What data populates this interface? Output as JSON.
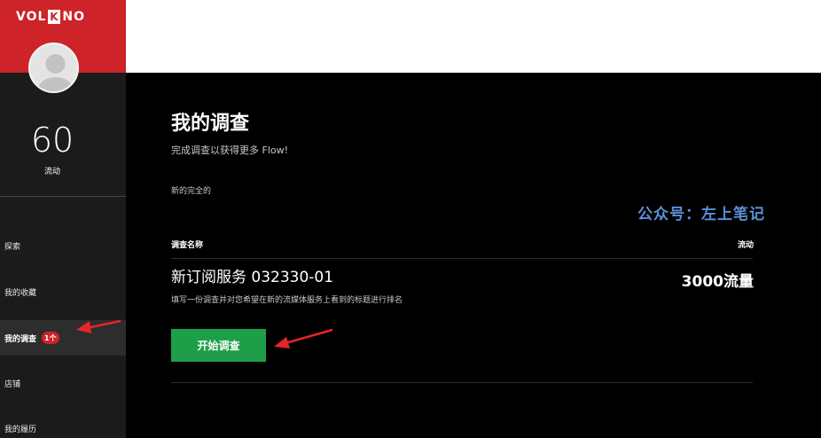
{
  "brand": {
    "logo_left": "VOL",
    "logo_box": "K",
    "logo_right": "NO"
  },
  "user": {
    "points": "60",
    "points_label": "流动"
  },
  "nav": {
    "items": [
      {
        "label": "探索"
      },
      {
        "label": "我的收藏"
      },
      {
        "label": "我的调查",
        "badge": "1个"
      },
      {
        "label": "店铺"
      },
      {
        "label": "我的履历"
      }
    ]
  },
  "main": {
    "title": "我的调查",
    "subtitle": "完成调查以获得更多 Flow!",
    "section_label": "新的完全的",
    "watermark": "公众号：左上笔记",
    "table": {
      "col_name": "调查名称",
      "col_flow": "流动"
    },
    "survey": {
      "name": "新订阅服务 032330-01",
      "description": "填写一份调查并对您希望在新的流媒体服务上看到的标题进行排名",
      "flow": "3000流量",
      "button": "开始调查"
    }
  },
  "colors": {
    "brand_red": "#cd2329",
    "button_green": "#1f9e49",
    "annotation_red": "#e8242b",
    "watermark_blue": "#5b8fd6"
  }
}
